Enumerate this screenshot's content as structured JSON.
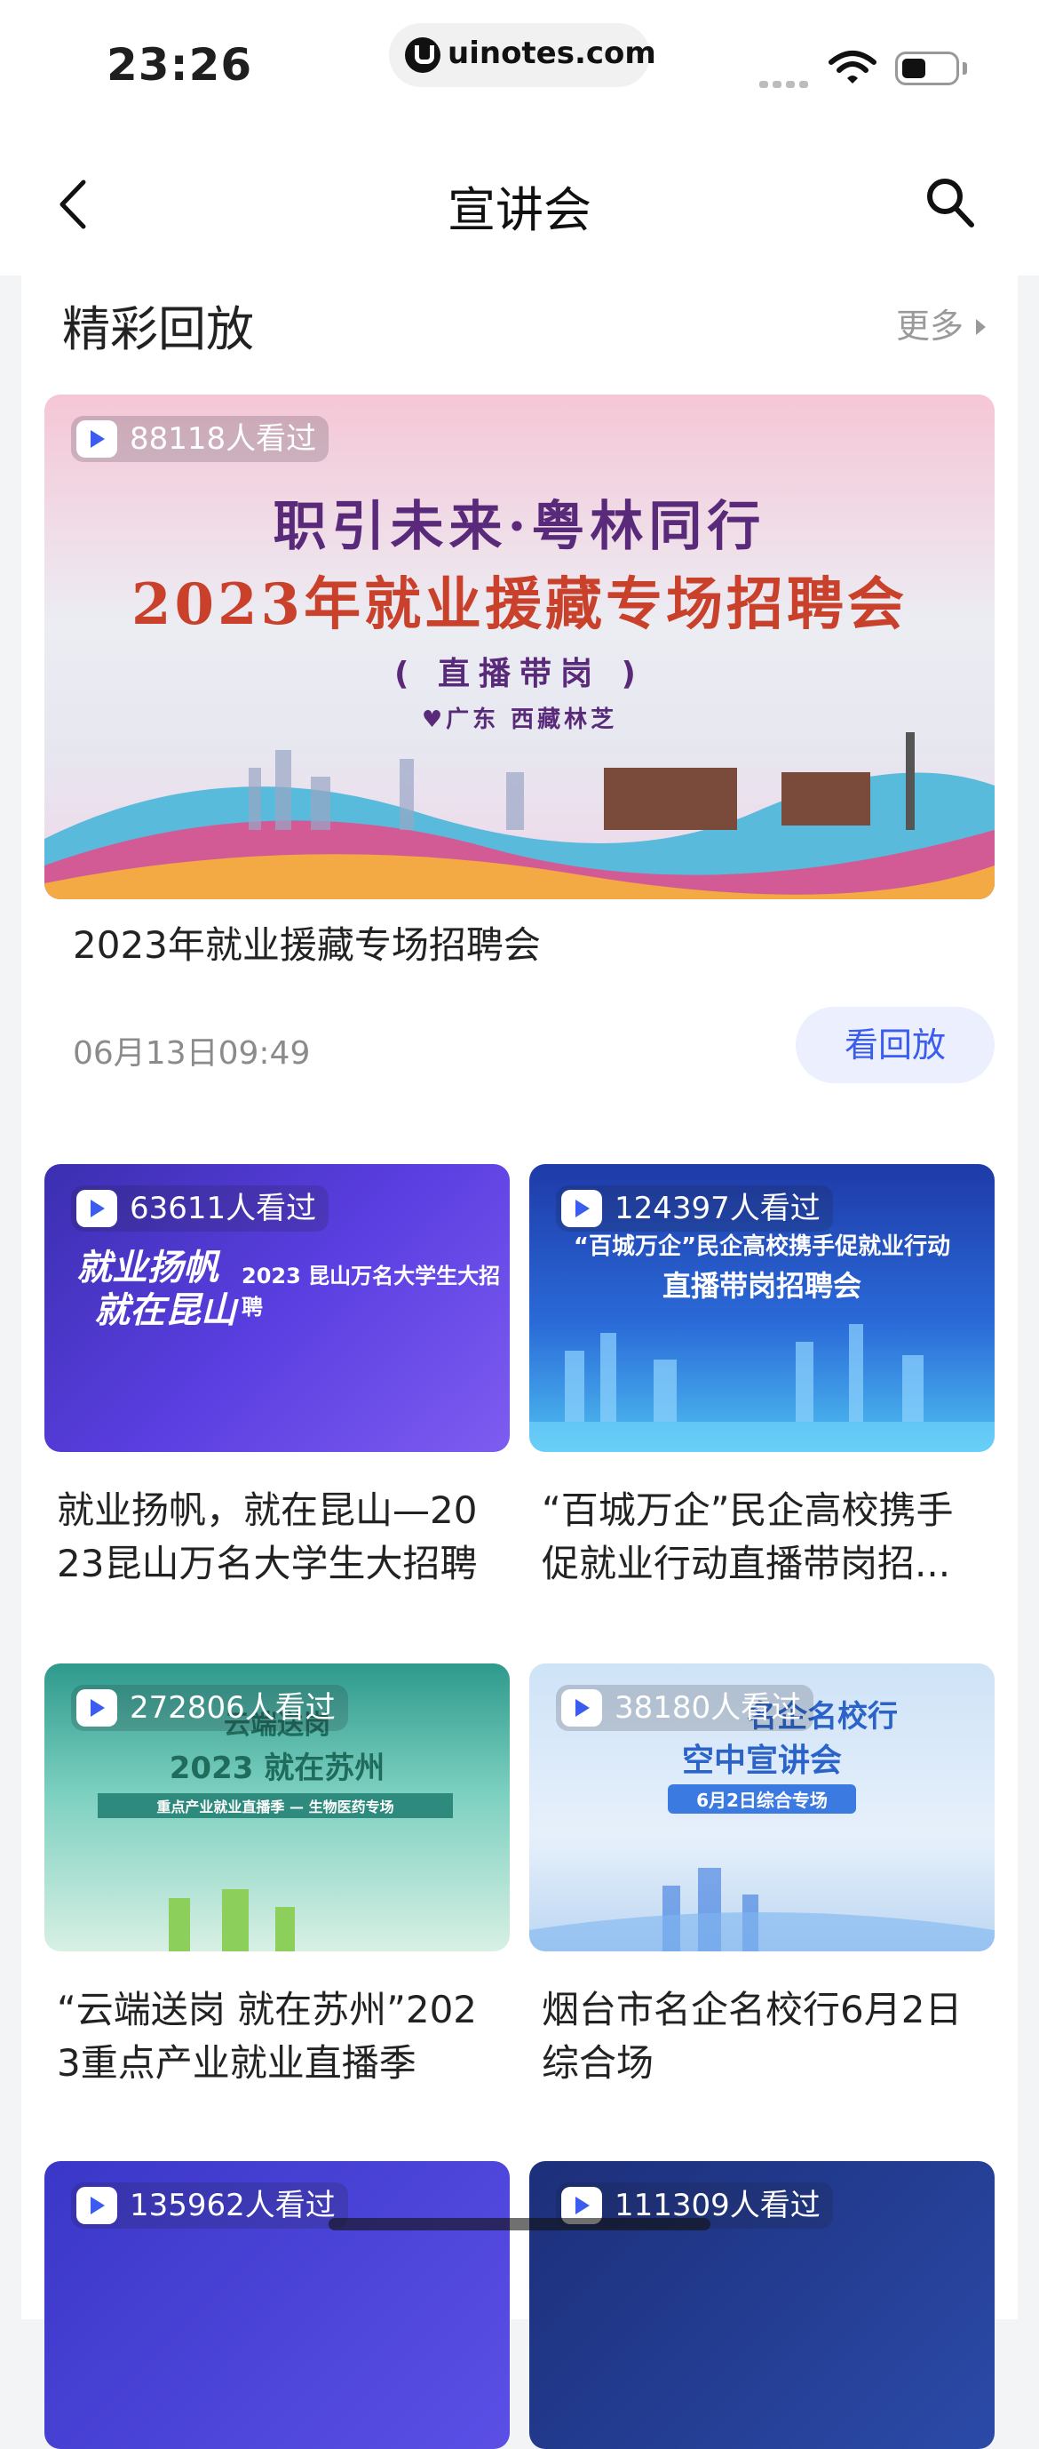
{
  "status_bar": {
    "time": "23:26",
    "url": "uinotes.com"
  },
  "nav": {
    "title": "宣讲会"
  },
  "section": {
    "title": "精彩回放",
    "more_label": "更多"
  },
  "featured": {
    "views": "88118人看过",
    "poster_line1": "职引未来·粤林同行",
    "poster_line2": "2023年就业援藏专场招聘会",
    "poster_line3": "( 直播带岗 )",
    "poster_line4": "♥广东 西藏林芝",
    "title": "2023年就业援藏专场招聘会",
    "date": "06月13日09:49",
    "replay_label": "看回放"
  },
  "grid": [
    {
      "views": "63611人看过",
      "title_line1": "就业扬帆，就在昆山—20",
      "title_line2": "23昆山万名大学生大招聘",
      "poster": [
        "就业扬帆",
        "就在昆山",
        "2023 昆山万名大学生大招聘"
      ]
    },
    {
      "views": "124397人看过",
      "title_line1": "“百城万企”民企高校携手",
      "title_line2": "促就业行动直播带岗招...",
      "poster": [
        "“百城万企”民企高校携手促就业行动",
        "直播带岗招聘会"
      ]
    },
    {
      "views": "272806人看过",
      "title_line1": "“云端送岗 就在苏州”202",
      "title_line2": "3重点产业就业直播季",
      "poster": [
        "云端送岗",
        "2023 就在苏州",
        "重点产业就业直播季 — 生物医药专场"
      ]
    },
    {
      "views": "38180人看过",
      "title_line1": "烟台市名企名校行6月2日",
      "title_line2": "综合场",
      "poster": [
        "名企名校行",
        "空中宣讲会",
        "6月2日综合专场"
      ]
    },
    {
      "views": "135962人看过"
    },
    {
      "views": "111309人看过"
    }
  ]
}
